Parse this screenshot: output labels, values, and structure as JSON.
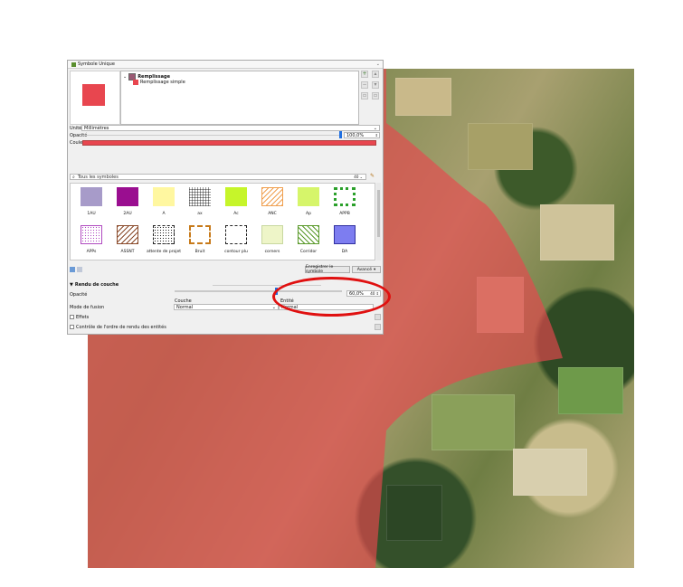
{
  "window": {
    "title": "Symbole Unique"
  },
  "symbol_tree": {
    "root_label": "Remplissage",
    "child_label": "Remplissage simple"
  },
  "colors": {
    "fill": "#e8464f",
    "tree_root_swatch": "#9b5a74",
    "accent": "#1f6fe0",
    "annotation": "#e01010"
  },
  "unit": {
    "label": "Unité",
    "value": "Millimètres"
  },
  "opacity": {
    "label": "Opacité",
    "value": "100,0%"
  },
  "color": {
    "label": "Couleur"
  },
  "search": {
    "placeholder": "Tous les symboles"
  },
  "symbols": [
    {
      "label": "1AU",
      "icon": "solid-lavender"
    },
    {
      "label": "2AU",
      "icon": "solid-purple"
    },
    {
      "label": "A",
      "icon": "solid-light-yellow"
    },
    {
      "label": "ax",
      "icon": "grid-hatch"
    },
    {
      "label": "Ac",
      "icon": "solid-lime"
    },
    {
      "label": "ANC",
      "icon": "orange-diagonal-hatch"
    },
    {
      "label": "Ap",
      "icon": "solid-yellow-green"
    },
    {
      "label": "APPB",
      "icon": "green-dotted-border"
    },
    {
      "label": "APPs",
      "icon": "purple-dots"
    },
    {
      "label": "ASSNT",
      "icon": "brown-diagonal-hatch"
    },
    {
      "label": "attente de projet",
      "icon": "black-dots"
    },
    {
      "label": "Bruit",
      "icon": "orange-dashed-border"
    },
    {
      "label": "contour plu",
      "icon": "black-dashed-border"
    },
    {
      "label": "corners",
      "icon": "pale-green-corners"
    },
    {
      "label": "Corridor",
      "icon": "green-diagonal-hatch"
    },
    {
      "label": "DA",
      "icon": "solid-blue"
    }
  ],
  "buttons": {
    "save_symbol": "Enregistrer le symbole",
    "advanced": "Avancé"
  },
  "layer_rendering": {
    "section_title": "Rendu de couche",
    "opacity_label": "Opacité",
    "opacity_value": "60,0%",
    "opacity_level": 0.6,
    "blend_label": "Mode de fusion",
    "layer_label": "Couche",
    "layer_value": "Normal",
    "entity_label": "Entité",
    "entity_value": "Normal",
    "effects_label": "Effets",
    "order_label": "Contrôle de l'ordre de rendu des entités"
  }
}
